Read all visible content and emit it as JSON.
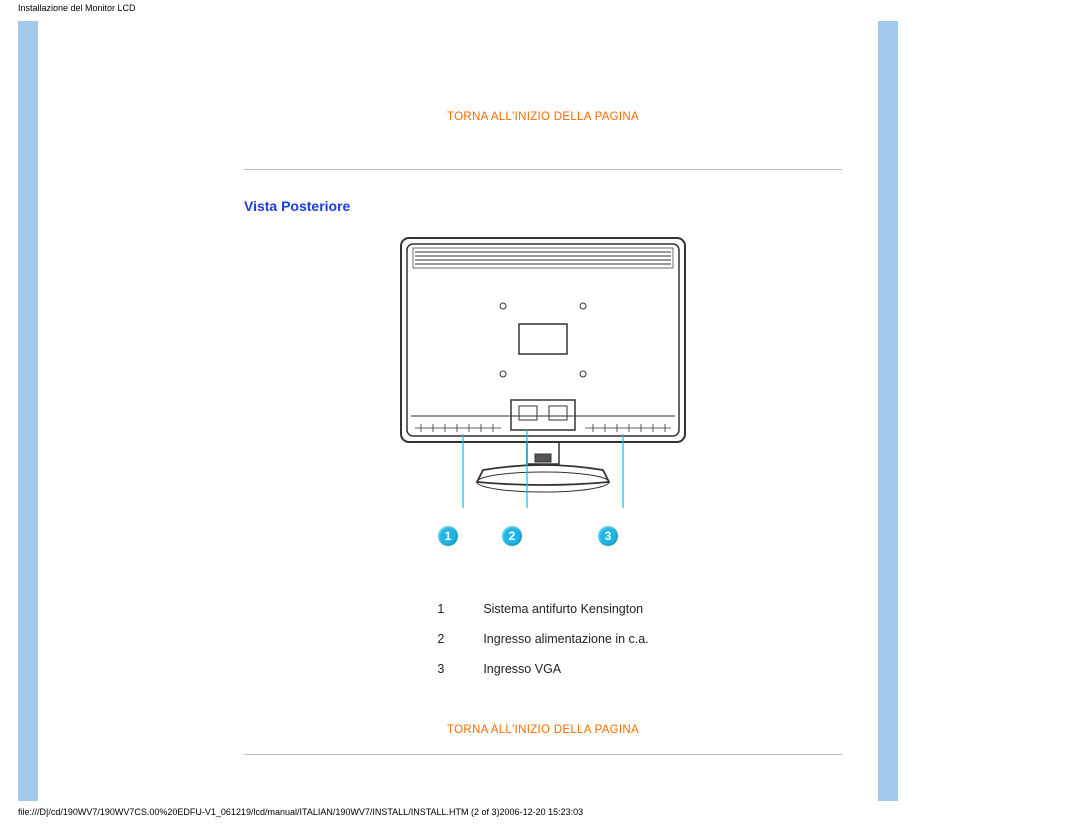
{
  "header": {
    "doc_title": "Installazione del Monitor LCD"
  },
  "links": {
    "back_to_top": "TORNA ALL'INIZIO DELLA PAGINA"
  },
  "section": {
    "title": "Vista Posteriore"
  },
  "callouts": {
    "c1": "1",
    "c2": "2",
    "c3": "3"
  },
  "legend": {
    "row1_num": "1",
    "row1_text": "Sistema antifurto Kensington",
    "row2_num": "2",
    "row2_text": "Ingresso alimentazione in c.a.",
    "row3_num": "3",
    "row3_text": "Ingresso VGA"
  },
  "footer": {
    "path": "file:///D|/cd/190WV7/190WV7CS.00%20EDFU-V1_061219/lcd/manual/ITALIAN/190WV7/INSTALL/INSTALL.HTM (2 of 3)2006-12-20 15:23:03"
  }
}
